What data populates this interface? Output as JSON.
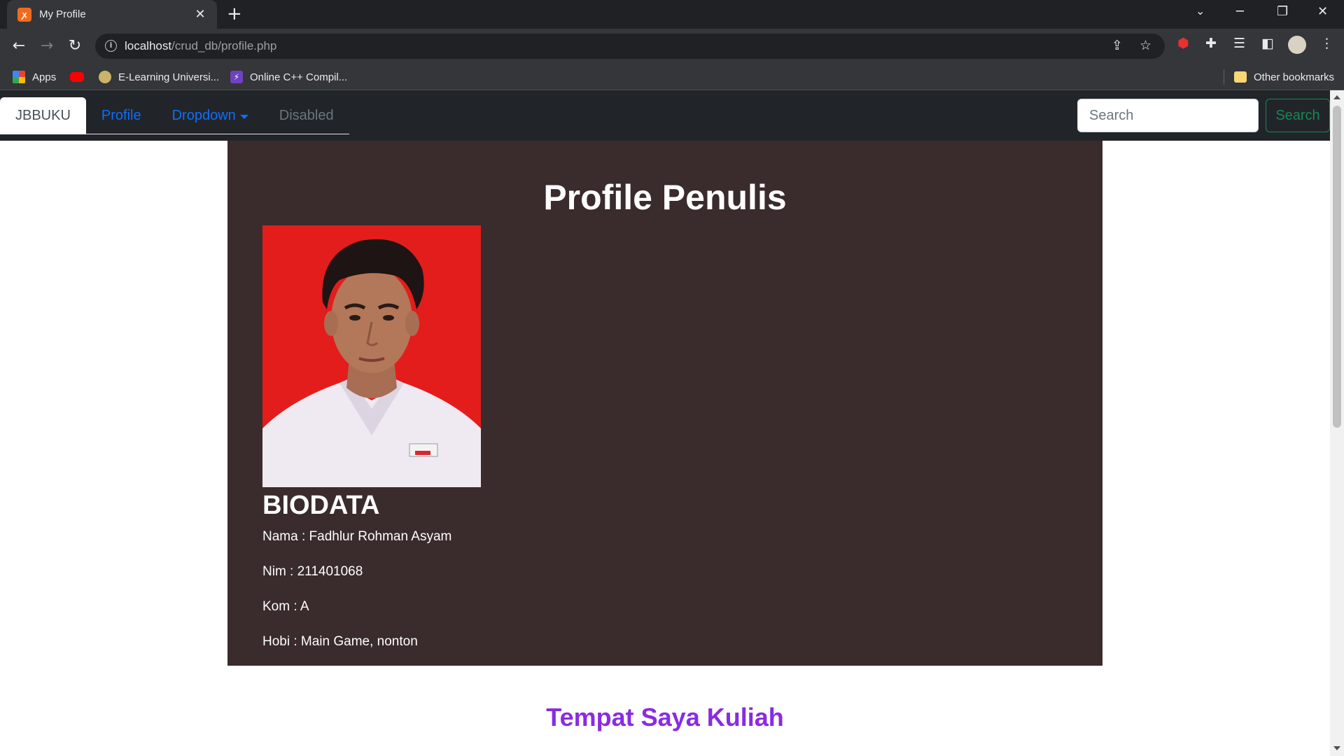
{
  "browser": {
    "tab_title": "My Profile",
    "tab_favicon": "xampp-icon",
    "url_host": "localhost",
    "url_path": "/crud_db/profile.php",
    "bookmarks": [
      {
        "label": "Apps",
        "icon": "apps-grid-icon"
      },
      {
        "label": "",
        "icon": "youtube-icon"
      },
      {
        "label": "E-Learning Universi...",
        "icon": "university-icon"
      },
      {
        "label": "Online C++ Compil...",
        "icon": "lightning-icon"
      }
    ],
    "other_bookmarks": "Other bookmarks"
  },
  "navbar": {
    "brand": "JBBUKU",
    "profile": "Profile",
    "dropdown": "Dropdown",
    "disabled": "Disabled",
    "search_placeholder": "Search",
    "search_button": "Search"
  },
  "profile": {
    "title": "Profile Penulis",
    "photo": "portrait-photo",
    "biodata_heading": "BIODATA",
    "lines": [
      "Nama : Fadhlur Rohman Asyam",
      "Nim : 211401068",
      "Kom : A",
      "Hobi : Main Game, nonton"
    ]
  },
  "section2": {
    "title": "Tempat Saya Kuliah"
  },
  "colors": {
    "navbar_bg": "#212529",
    "profile_bg": "#3a2b2c",
    "link": "#0d6efd",
    "search_btn": "#198754",
    "kuliah_title": "#8a2be2",
    "photo_bg": "#e31d1c"
  }
}
